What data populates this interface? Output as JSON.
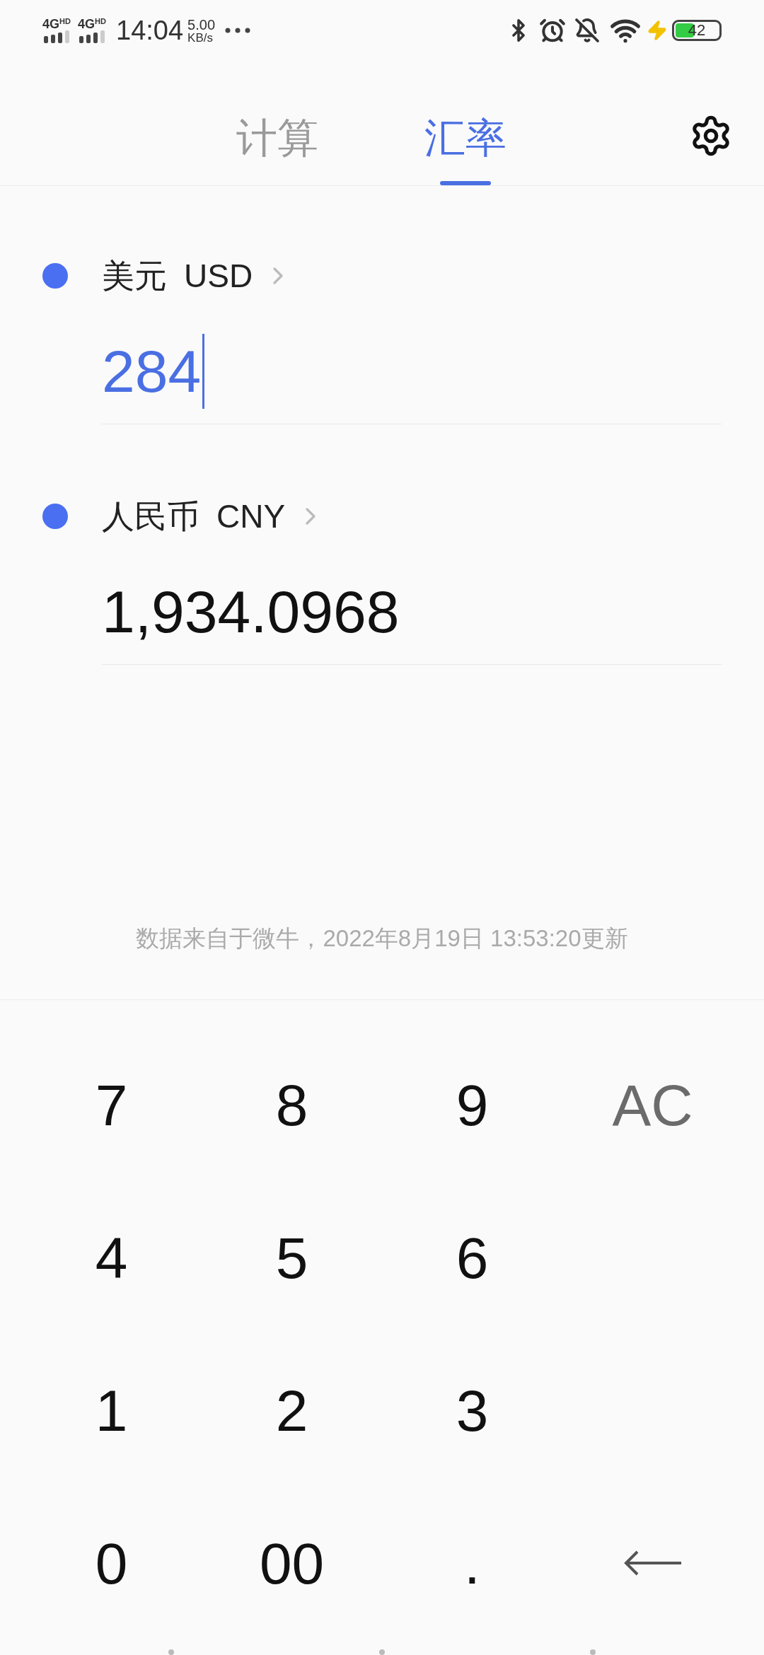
{
  "status_bar": {
    "networks": [
      {
        "type": "4G",
        "badge": "HD"
      },
      {
        "type": "4G",
        "badge": "HD"
      }
    ],
    "time": "14:04",
    "speed": "5.00",
    "speed_unit": "KB/s",
    "battery": "42"
  },
  "tabs": [
    {
      "label": "计算",
      "selected": false
    },
    {
      "label": "汇率",
      "selected": true
    }
  ],
  "currencies": [
    {
      "name": "美元",
      "code": "USD",
      "amount": "284",
      "active": true
    },
    {
      "name": "人民币",
      "code": "CNY",
      "amount": "1,934.0968",
      "active": false
    }
  ],
  "source_note": "数据来自于微牛，2022年8月19日 13:53:20更新",
  "keypad": [
    {
      "keys": [
        {
          "kind": "digit",
          "label": "7"
        },
        {
          "kind": "digit",
          "label": "8"
        },
        {
          "kind": "digit",
          "label": "9"
        },
        {
          "kind": "clear",
          "label": "AC"
        }
      ]
    },
    {
      "keys": [
        {
          "kind": "digit",
          "label": "4"
        },
        {
          "kind": "digit",
          "label": "5"
        },
        {
          "kind": "digit",
          "label": "6"
        }
      ]
    },
    {
      "keys": [
        {
          "kind": "digit",
          "label": "1"
        },
        {
          "kind": "digit",
          "label": "2"
        },
        {
          "kind": "digit",
          "label": "3"
        }
      ]
    },
    {
      "keys": [
        {
          "kind": "digit",
          "label": "0"
        },
        {
          "kind": "digit",
          "label": "00"
        },
        {
          "kind": "digit",
          "label": "."
        },
        {
          "kind": "backspace"
        }
      ]
    }
  ]
}
